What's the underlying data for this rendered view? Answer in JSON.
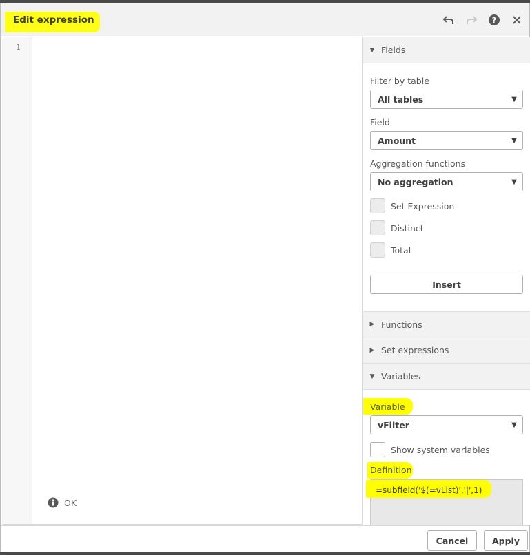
{
  "dialog": {
    "title": "Edit expression"
  },
  "editor": {
    "line_number": "1",
    "status_text": "OK"
  },
  "panel": {
    "fields_section": {
      "label": "Fields",
      "filter_by_table_label": "Filter by table",
      "filter_by_table_value": "All tables",
      "field_label": "Field",
      "field_value": "Amount",
      "aggregation_label": "Aggregation functions",
      "aggregation_value": "No aggregation",
      "checkboxes": [
        "Set Expression",
        "Distinct",
        "Total"
      ],
      "insert_label": "Insert"
    },
    "functions_section": {
      "label": "Functions"
    },
    "set_expressions_section": {
      "label": "Set expressions"
    },
    "variables_section": {
      "label": "Variables",
      "variable_label": "Variable",
      "variable_value": "vFilter",
      "show_system_label": "Show system variables",
      "definition_label": "Definition",
      "definition_value": "=subfield('$(=vList)','|',1)"
    }
  },
  "footer": {
    "cancel_label": "Cancel",
    "apply_label": "Apply"
  },
  "colors": {
    "highlight": "#ffff00",
    "header_bg": "#f2f2f2",
    "text": "#404040"
  }
}
